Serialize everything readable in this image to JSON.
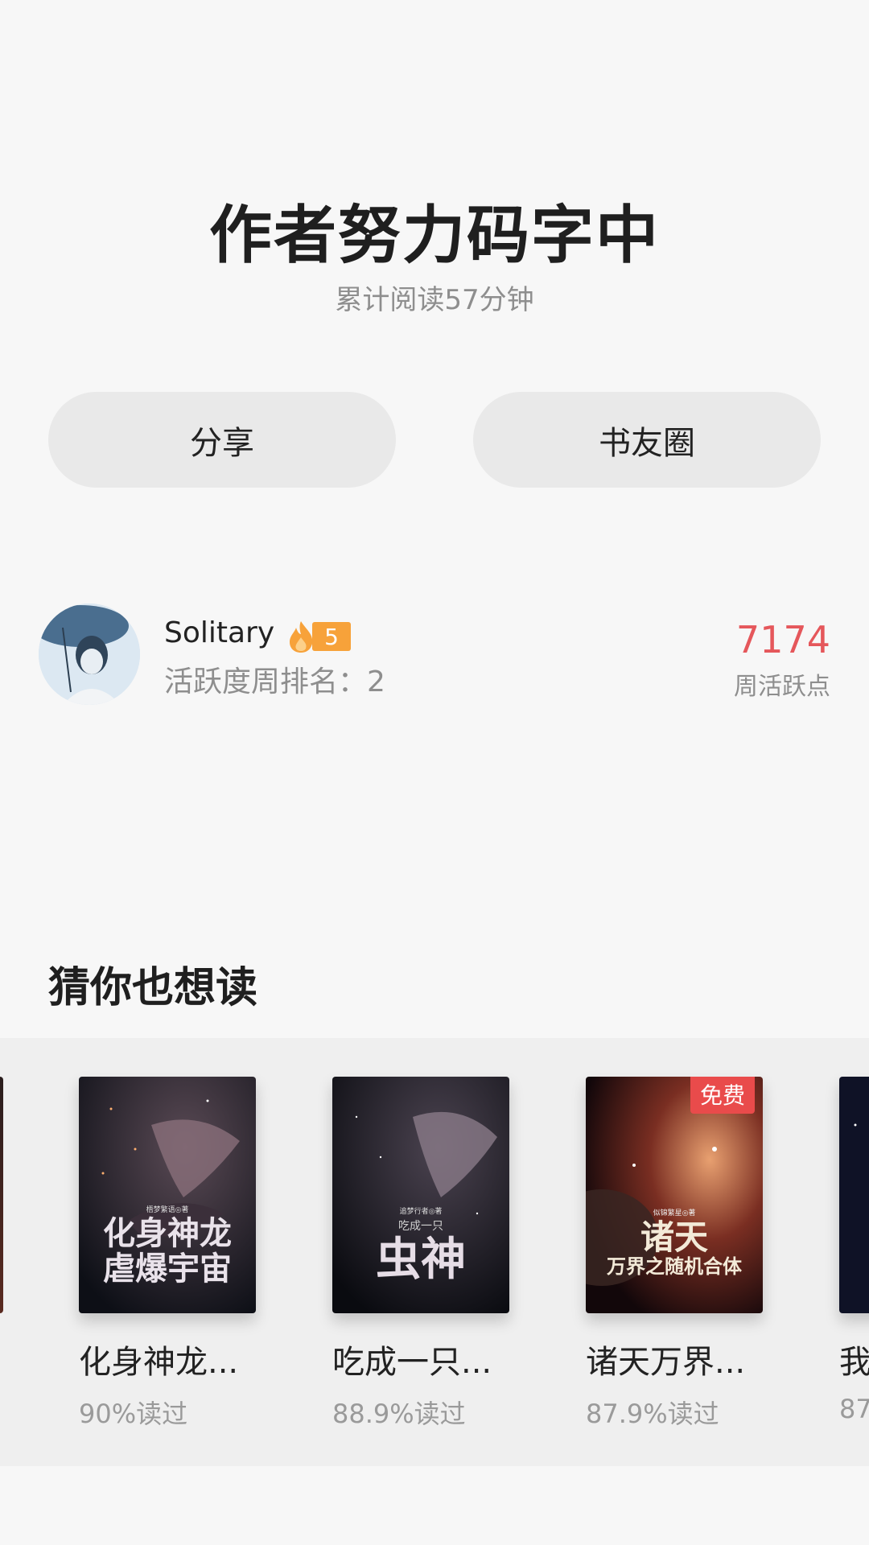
{
  "header": {
    "title": "作者努力码字中",
    "subtitle": "累计阅读57分钟"
  },
  "actions": {
    "share_label": "分享",
    "circle_label": "书友圈"
  },
  "user": {
    "name": "Solitary",
    "level": "5",
    "rank_text": "活跃度周排名：2",
    "weekly_points": "7174",
    "weekly_points_label": "周活跃点"
  },
  "recommend": {
    "section_title": "猜你也想读",
    "books": [
      {
        "title": "化身神龙...",
        "read": "90%读过",
        "cover_text": [
          "化身神龙",
          "虐爆宇宙"
        ],
        "cover_author": "梧梦繁语◎著",
        "badge": ""
      },
      {
        "title": "吃成一只...",
        "read": "88.9%读过",
        "cover_text": [
          "吃成一只",
          "虫神"
        ],
        "cover_author": "追梦行者◎著",
        "badge": ""
      },
      {
        "title": "诸天万界...",
        "read": "87.9%读过",
        "cover_text": [
          "诸天",
          "万界之随机合体"
        ],
        "cover_author": "似锦繁星◎著",
        "badge": "免费"
      },
      {
        "title": "我",
        "read": "87",
        "cover_text": [],
        "cover_author": "",
        "badge": ""
      }
    ]
  },
  "colors": {
    "accent_red": "#e5575b",
    "badge_orange": "#f7a23a",
    "free_badge": "#e94b4b"
  }
}
